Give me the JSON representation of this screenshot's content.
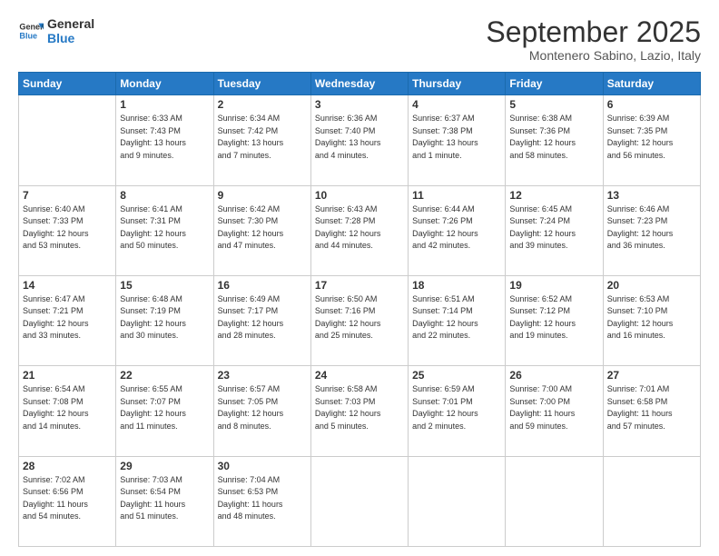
{
  "logo": {
    "line1": "General",
    "line2": "Blue"
  },
  "title": "September 2025",
  "location": "Montenero Sabino, Lazio, Italy",
  "header": {
    "days": [
      "Sunday",
      "Monday",
      "Tuesday",
      "Wednesday",
      "Thursday",
      "Friday",
      "Saturday"
    ]
  },
  "weeks": [
    [
      {
        "day": "",
        "info": ""
      },
      {
        "day": "1",
        "info": "Sunrise: 6:33 AM\nSunset: 7:43 PM\nDaylight: 13 hours\nand 9 minutes."
      },
      {
        "day": "2",
        "info": "Sunrise: 6:34 AM\nSunset: 7:42 PM\nDaylight: 13 hours\nand 7 minutes."
      },
      {
        "day": "3",
        "info": "Sunrise: 6:36 AM\nSunset: 7:40 PM\nDaylight: 13 hours\nand 4 minutes."
      },
      {
        "day": "4",
        "info": "Sunrise: 6:37 AM\nSunset: 7:38 PM\nDaylight: 13 hours\nand 1 minute."
      },
      {
        "day": "5",
        "info": "Sunrise: 6:38 AM\nSunset: 7:36 PM\nDaylight: 12 hours\nand 58 minutes."
      },
      {
        "day": "6",
        "info": "Sunrise: 6:39 AM\nSunset: 7:35 PM\nDaylight: 12 hours\nand 56 minutes."
      }
    ],
    [
      {
        "day": "7",
        "info": "Sunrise: 6:40 AM\nSunset: 7:33 PM\nDaylight: 12 hours\nand 53 minutes."
      },
      {
        "day": "8",
        "info": "Sunrise: 6:41 AM\nSunset: 7:31 PM\nDaylight: 12 hours\nand 50 minutes."
      },
      {
        "day": "9",
        "info": "Sunrise: 6:42 AM\nSunset: 7:30 PM\nDaylight: 12 hours\nand 47 minutes."
      },
      {
        "day": "10",
        "info": "Sunrise: 6:43 AM\nSunset: 7:28 PM\nDaylight: 12 hours\nand 44 minutes."
      },
      {
        "day": "11",
        "info": "Sunrise: 6:44 AM\nSunset: 7:26 PM\nDaylight: 12 hours\nand 42 minutes."
      },
      {
        "day": "12",
        "info": "Sunrise: 6:45 AM\nSunset: 7:24 PM\nDaylight: 12 hours\nand 39 minutes."
      },
      {
        "day": "13",
        "info": "Sunrise: 6:46 AM\nSunset: 7:23 PM\nDaylight: 12 hours\nand 36 minutes."
      }
    ],
    [
      {
        "day": "14",
        "info": "Sunrise: 6:47 AM\nSunset: 7:21 PM\nDaylight: 12 hours\nand 33 minutes."
      },
      {
        "day": "15",
        "info": "Sunrise: 6:48 AM\nSunset: 7:19 PM\nDaylight: 12 hours\nand 30 minutes."
      },
      {
        "day": "16",
        "info": "Sunrise: 6:49 AM\nSunset: 7:17 PM\nDaylight: 12 hours\nand 28 minutes."
      },
      {
        "day": "17",
        "info": "Sunrise: 6:50 AM\nSunset: 7:16 PM\nDaylight: 12 hours\nand 25 minutes."
      },
      {
        "day": "18",
        "info": "Sunrise: 6:51 AM\nSunset: 7:14 PM\nDaylight: 12 hours\nand 22 minutes."
      },
      {
        "day": "19",
        "info": "Sunrise: 6:52 AM\nSunset: 7:12 PM\nDaylight: 12 hours\nand 19 minutes."
      },
      {
        "day": "20",
        "info": "Sunrise: 6:53 AM\nSunset: 7:10 PM\nDaylight: 12 hours\nand 16 minutes."
      }
    ],
    [
      {
        "day": "21",
        "info": "Sunrise: 6:54 AM\nSunset: 7:08 PM\nDaylight: 12 hours\nand 14 minutes."
      },
      {
        "day": "22",
        "info": "Sunrise: 6:55 AM\nSunset: 7:07 PM\nDaylight: 12 hours\nand 11 minutes."
      },
      {
        "day": "23",
        "info": "Sunrise: 6:57 AM\nSunset: 7:05 PM\nDaylight: 12 hours\nand 8 minutes."
      },
      {
        "day": "24",
        "info": "Sunrise: 6:58 AM\nSunset: 7:03 PM\nDaylight: 12 hours\nand 5 minutes."
      },
      {
        "day": "25",
        "info": "Sunrise: 6:59 AM\nSunset: 7:01 PM\nDaylight: 12 hours\nand 2 minutes."
      },
      {
        "day": "26",
        "info": "Sunrise: 7:00 AM\nSunset: 7:00 PM\nDaylight: 11 hours\nand 59 minutes."
      },
      {
        "day": "27",
        "info": "Sunrise: 7:01 AM\nSunset: 6:58 PM\nDaylight: 11 hours\nand 57 minutes."
      }
    ],
    [
      {
        "day": "28",
        "info": "Sunrise: 7:02 AM\nSunset: 6:56 PM\nDaylight: 11 hours\nand 54 minutes."
      },
      {
        "day": "29",
        "info": "Sunrise: 7:03 AM\nSunset: 6:54 PM\nDaylight: 11 hours\nand 51 minutes."
      },
      {
        "day": "30",
        "info": "Sunrise: 7:04 AM\nSunset: 6:53 PM\nDaylight: 11 hours\nand 48 minutes."
      },
      {
        "day": "",
        "info": ""
      },
      {
        "day": "",
        "info": ""
      },
      {
        "day": "",
        "info": ""
      },
      {
        "day": "",
        "info": ""
      }
    ]
  ]
}
